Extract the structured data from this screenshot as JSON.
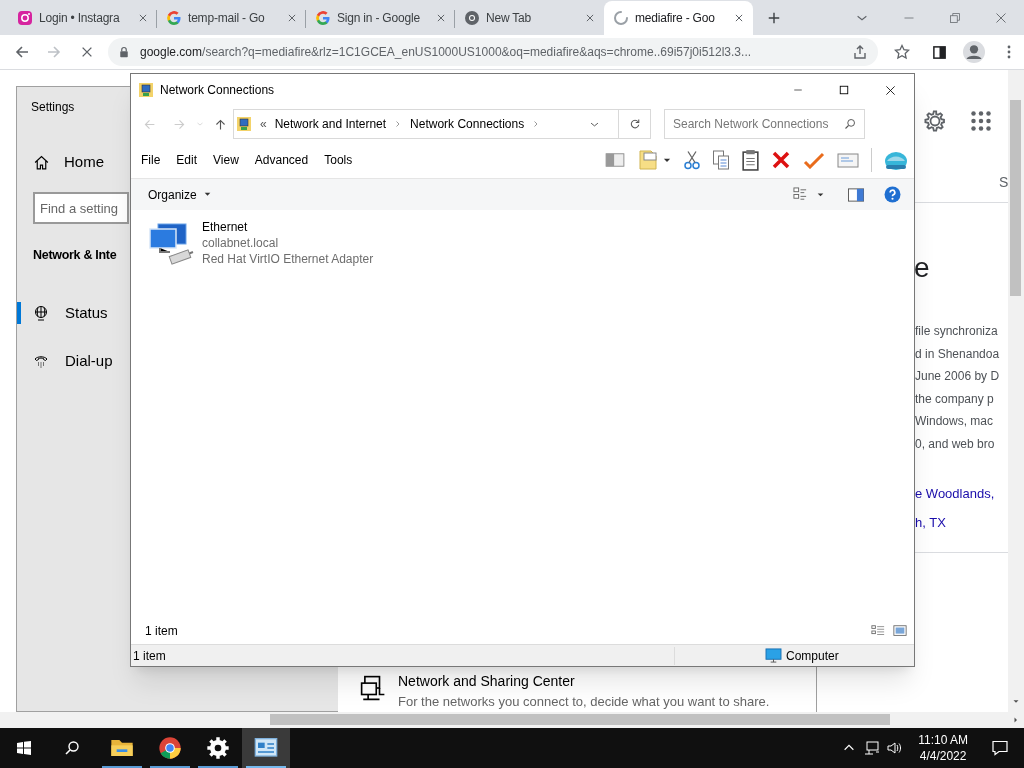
{
  "browser": {
    "tabs": [
      {
        "title": "Login • Instagra",
        "kind": "instagram",
        "selected": false
      },
      {
        "title": "temp-mail - Go",
        "kind": "google",
        "selected": false
      },
      {
        "title": "Sign in - Google",
        "kind": "google",
        "selected": false
      },
      {
        "title": "New Tab",
        "kind": "chrome",
        "selected": false
      },
      {
        "title": "mediafire - Goo",
        "kind": "loading",
        "selected": true
      }
    ],
    "url_host": "google.com",
    "url_rest": "/search?q=mediafire&rlz=1C1GCEA_enUS1000US1000&oq=mediafire&aqs=chrome..69i57j0i512l3.3...",
    "page": {
      "tab_fragment": "S",
      "heading_fragment": "e",
      "lines": [
        "file synchroniza",
        "d in Shenandoa",
        "June 2006 by D",
        "the company p",
        "Windows, mac",
        "0, and web bro"
      ],
      "links": [
        "e Woodlands,",
        "h, TX"
      ]
    }
  },
  "settings": {
    "title": "Settings",
    "home": "Home",
    "search_placeholder": "Find a setting",
    "section": "Network & Inte",
    "nav": [
      {
        "label": "Status",
        "kind": "globe",
        "selected": true
      },
      {
        "label": "Dial-up",
        "kind": "phone",
        "selected": false
      }
    ],
    "link": {
      "title": "Network and Sharing Center",
      "description": "For the networks you connect to, decide what you want to share."
    }
  },
  "explorer": {
    "title": "Network Connections",
    "breadcrumb": [
      "«",
      "Network and Internet",
      "Network Connections"
    ],
    "search_placeholder": "Search Network Connections",
    "menu": [
      "File",
      "Edit",
      "View",
      "Advanced",
      "Tools"
    ],
    "organize": "Organize",
    "items": [
      {
        "name": "Ethernet",
        "network": "collabnet.local",
        "device": "Red Hat VirtIO Ethernet Adapter"
      }
    ],
    "count": "1 item",
    "status_count": "1 item",
    "status_location": "Computer"
  },
  "taskbar": {
    "apps": [
      {
        "kind": "explorer",
        "selected": false
      },
      {
        "kind": "chrome",
        "selected": false
      },
      {
        "kind": "settings",
        "selected": false
      },
      {
        "kind": "control",
        "selected": true
      }
    ],
    "time": "11:10 AM",
    "date": "4/4/2022"
  }
}
